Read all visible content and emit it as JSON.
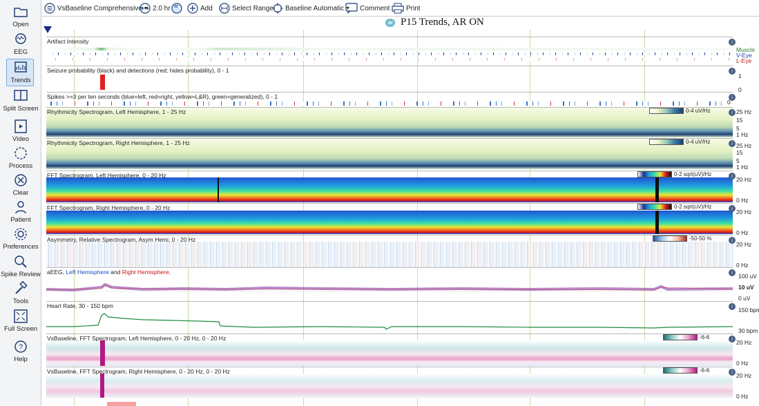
{
  "sidebar": {
    "items": [
      {
        "label": "Open",
        "icon": "folder-icon"
      },
      {
        "label": "EEG",
        "icon": "eeg-head-icon"
      },
      {
        "label": "Trends",
        "icon": "trends-chart-icon"
      },
      {
        "label": "Split Screen",
        "icon": "split-screen-icon"
      },
      {
        "label": "Video",
        "icon": "video-film-icon"
      },
      {
        "label": "Process",
        "icon": "process-gear-icon"
      },
      {
        "label": "Clear",
        "icon": "clear-x-icon"
      },
      {
        "label": "Patient",
        "icon": "patient-person-icon"
      },
      {
        "label": "Preferences",
        "icon": "preferences-gear-icon"
      },
      {
        "label": "Spike Review",
        "icon": "spike-review-magnifier-icon"
      },
      {
        "label": "Tools",
        "icon": "tools-hammer-icon"
      },
      {
        "label": "Full Screen",
        "icon": "full-screen-icon"
      },
      {
        "label": "Help",
        "icon": "help-question-icon"
      }
    ],
    "active": "Trends"
  },
  "toolbar": {
    "layout_label": "VsBaseline Comprehensive",
    "duration_label": "2.0 hr",
    "ar_badge": "ar",
    "add_label": "Add",
    "select_range_label": "Select Range",
    "baseline_label": "Baseline Automatic",
    "comment_label": "Comment",
    "print_label": "Print"
  },
  "title": "P15 Trends, AR ON",
  "panels": {
    "artifact": {
      "title": "Artifact Intensity",
      "legend": [
        "Muscle",
        "V-Eye",
        "L-Eye"
      ]
    },
    "seizure": {
      "title": "Seizure probability (black) and detections (red; hides probability),  0 - 1",
      "axis_top": "1",
      "axis_bottom": "0"
    },
    "spikes": {
      "title": "Spikes >=3 per ten seconds (blue=left, red=right, yellow=L&R), green=generalized),  0 - 1",
      "axis": "0"
    },
    "rhythm_left": {
      "title": "Rhythmicity Spectrogram, Left Hemisphere, 1 - 25 Hz",
      "scale": "0-4 uV/Hz",
      "ticks": [
        "25 Hz",
        "15",
        "5",
        "1 Hz"
      ]
    },
    "rhythm_right": {
      "title": "Rhythmicity Spectrogram, Right Hemisphere, 1 - 25 Hz",
      "scale": "0-4 uV/Hz",
      "ticks": [
        "25 Hz",
        "15",
        "5",
        "1 Hz"
      ]
    },
    "fft_left": {
      "title": "FFT Spectrogram, Left Hemisphere, 0 - 20 Hz",
      "scale": "0-2 sqrt(uV)/Hz",
      "ticks": [
        "20 Hz",
        "0 Hz"
      ]
    },
    "fft_right": {
      "title": "FFT Spectrogram, Right Hemisphere, 0 - 20 Hz",
      "scale": "0-2 sqrt(uV)/Hz",
      "ticks": [
        "20 Hz",
        "0 Hz"
      ]
    },
    "asym": {
      "title": "Asymmetry, Relative Spectrogram, Asym Hemi, 0 - 20 Hz",
      "scale": "-50-50 %",
      "ticks": [
        "20 Hz",
        "0 Hz"
      ]
    },
    "aeeg": {
      "title_prefix": "aEEG, ",
      "title_left": "Left Hemisphere",
      "title_mid": " and ",
      "title_right": "Right Hemisphere,",
      "ticks": [
        "100 uV",
        "10 uV",
        "0 uV"
      ]
    },
    "heart": {
      "title": "Heart Rate, 30 - 150 bpm",
      "ticks": [
        "150 bpm",
        "30 bpm"
      ]
    },
    "vsb_left": {
      "title": "VsBaseline, FFT Spectrogram, Left Hemisphere, 0 - 20 Hz, 0 - 20 Hz",
      "scale": "-6-6",
      "ticks": [
        "20 Hz",
        "0 Hz"
      ]
    },
    "vsb_right": {
      "title": "VsBaseline, FFT Spectrogram, Right Hemisphere, 0 - 20 Hz, 0 - 20 Hz",
      "scale": "-6-6",
      "ticks": [
        "20 Hz",
        "0 Hz"
      ]
    }
  },
  "colors": {
    "rhythm_bg": "#eef5cf",
    "fft_blue": "#1f5fd6",
    "fft_red": "#e01818",
    "aeeg_purple": "#9b55b0",
    "heart_green": "#1e8a3c",
    "vsb_teal": "#2a8a8a",
    "vsb_magenta": "#c01a80",
    "seizure_red": "#e02020"
  }
}
